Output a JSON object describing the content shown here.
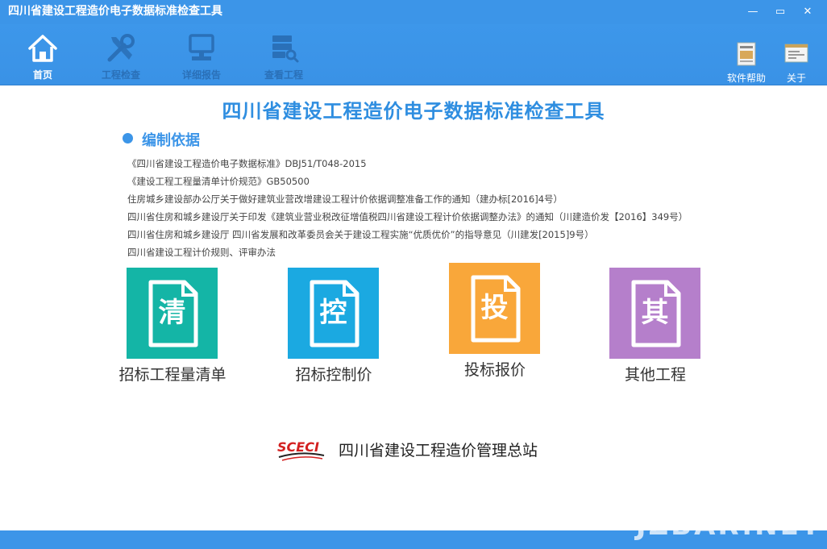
{
  "window": {
    "title": "四川省建设工程造价电子数据标准检查工具",
    "minimize_glyph": "—",
    "restore_glyph": "▭",
    "close_glyph": "✕"
  },
  "toolbar": {
    "items": [
      {
        "label": "首页",
        "icon": "home-icon",
        "active": true
      },
      {
        "label": "工程检查",
        "icon": "tools-icon",
        "active": false
      },
      {
        "label": "详细报告",
        "icon": "monitor-icon",
        "active": false
      },
      {
        "label": "查看工程",
        "icon": "database-search-icon",
        "active": false
      }
    ],
    "right": [
      {
        "label": "软件帮助",
        "icon": "help-doc-icon"
      },
      {
        "label": "关于",
        "icon": "about-window-icon"
      }
    ]
  },
  "main": {
    "title": "四川省建设工程造价电子数据标准检查工具",
    "section_title": "编制依据",
    "basis": [
      "《四川省建设工程造价电子数据标准》DBJ51/T048-2015",
      "《建设工程工程量清单计价规范》GB50500",
      "住房城乡建设部办公厅关于做好建筑业营改增建设工程计价依据调整准备工作的通知（建办标[2016]4号）",
      "四川省住房和城乡建设厅关于印发《建筑业营业税改征增值税四川省建设工程计价依据调整办法》的通知（川建造价发【2016】349号）",
      "四川省住房和城乡建设厅 四川省发展和改革委员会关于建设工程实施“优质优价”的指导意见（川建发[2015]9号）",
      "四川省建设工程计价规则、评审办法"
    ],
    "tiles": [
      {
        "char": "清",
        "label": "招标工程量清单",
        "color": "#14b5a6"
      },
      {
        "char": "控",
        "label": "招标控制价",
        "color": "#1ba9e1"
      },
      {
        "char": "投",
        "label": "投标报价",
        "color": "#f9a73a"
      },
      {
        "char": "其",
        "label": "其他工程",
        "color": "#b57fcb"
      }
    ]
  },
  "footer": {
    "logo_text": "SCECI",
    "org_name": "四川省建设工程造价管理总站",
    "watermark": "JZBAR.NET"
  },
  "colors": {
    "accent": "#3c95e8",
    "title_blue": "#2f8ee0"
  }
}
